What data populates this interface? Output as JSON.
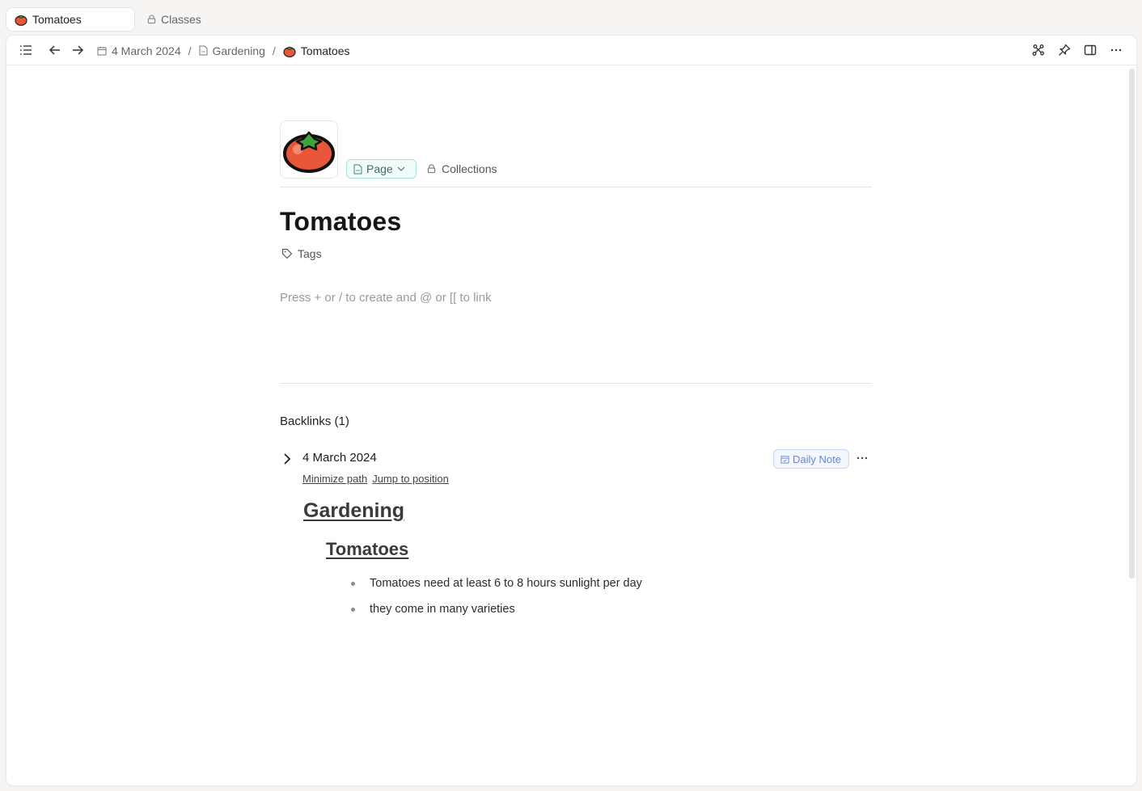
{
  "tabs": [
    {
      "label": "Tomatoes",
      "icon": "tomato-icon",
      "active": true
    },
    {
      "label": "Classes",
      "icon": "lock-icon",
      "active": false
    }
  ],
  "toolbar": {
    "buttons_left": [
      "list-icon",
      "arrow-left-icon",
      "arrow-right-icon"
    ],
    "buttons_right": [
      "graph-icon",
      "pin-icon",
      "sidebar-icon",
      "more-icon"
    ],
    "breadcrumb": [
      {
        "label": "4 March 2024",
        "icon": "calendar-icon"
      },
      {
        "label": "Gardening",
        "icon": "page-icon"
      },
      {
        "label": "Tomatoes",
        "icon": "tomato-icon"
      }
    ],
    "separator": "/"
  },
  "page": {
    "type_label": "Page",
    "collections_label": "Collections",
    "title": "Tomatoes",
    "tags_label": "Tags",
    "editor_placeholder": "Press + or / to create and @ or [[ to link"
  },
  "backlinks": {
    "heading": "Backlinks (1)",
    "items": [
      {
        "title": "4 March 2024",
        "badge": "Daily Note",
        "actions": [
          "Minimize path",
          "Jump to position"
        ],
        "path": [
          "Gardening",
          "Tomatoes"
        ],
        "bullets": [
          "Tomatoes need at least 6 to 8 hours sunlight per day",
          "they come in many varieties"
        ]
      }
    ]
  },
  "colors": {
    "accent_page_badge": "#a7e3d8",
    "daily_note_badge": "#6e86c8",
    "tomato": "#e9573a",
    "leaf": "#3fa53a"
  }
}
